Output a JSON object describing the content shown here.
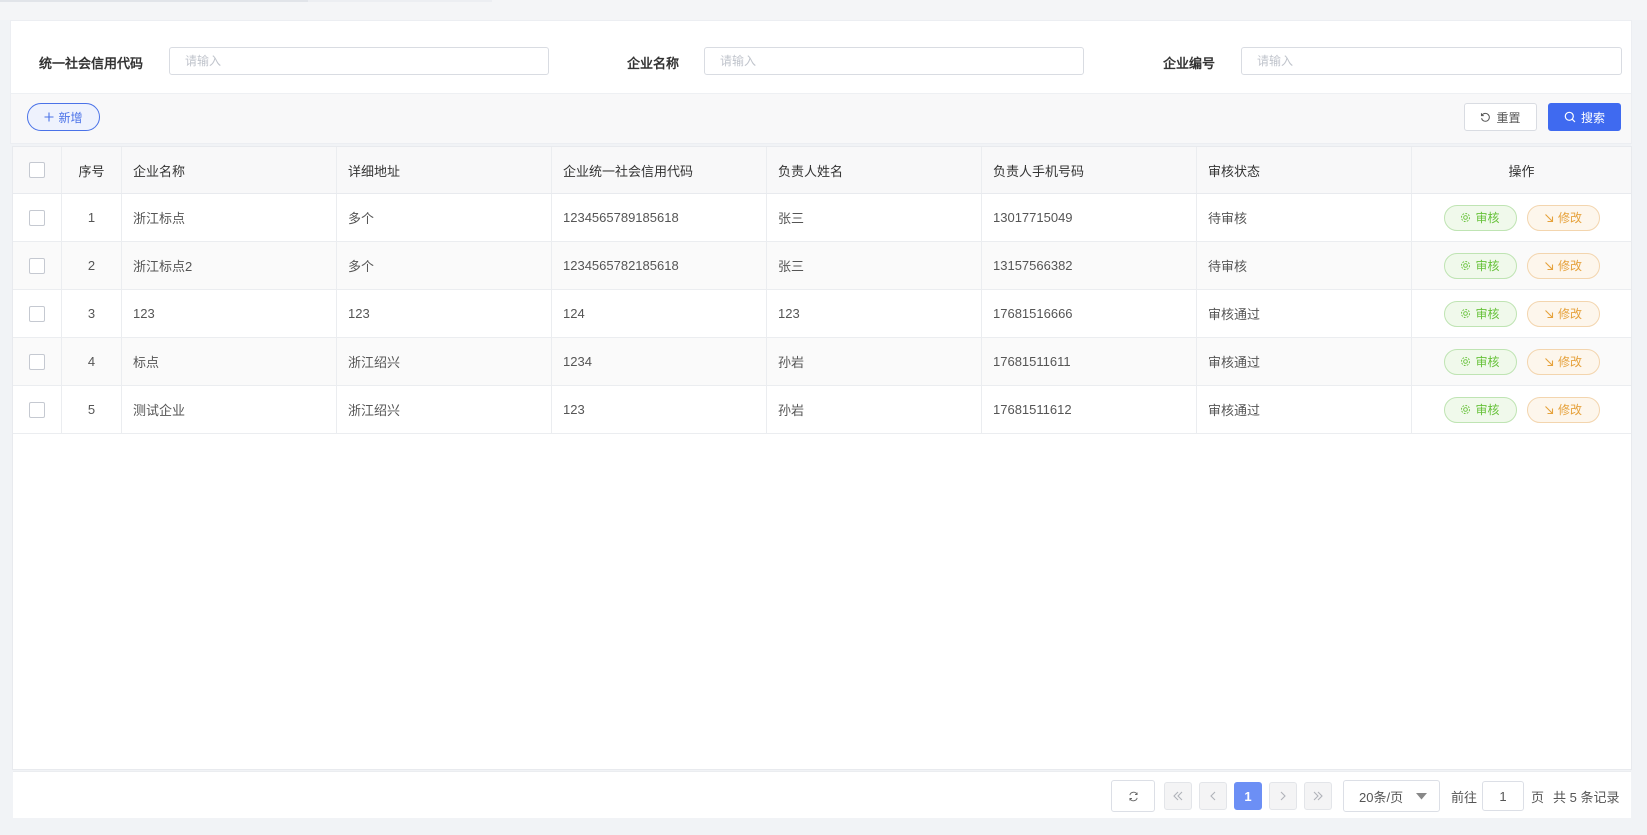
{
  "filters": [
    {
      "label": "统一社会信用代码",
      "placeholder": "请输入",
      "value": ""
    },
    {
      "label": "企业名称",
      "placeholder": "请输入",
      "value": ""
    },
    {
      "label": "企业编号",
      "placeholder": "请输入",
      "value": ""
    }
  ],
  "toolbar": {
    "add_label": "新增",
    "reset_label": "重置",
    "search_label": "搜索"
  },
  "table": {
    "columns": [
      "序号",
      "企业名称",
      "详细地址",
      "企业统一社会信用代码",
      "负责人姓名",
      "负责人手机号码",
      "审核状态",
      "操作"
    ],
    "rows": [
      {
        "index": "1",
        "name": "浙江标点",
        "address": "多个",
        "credit_code": "1234565789185618",
        "manager": "张三",
        "phone": "13017715049",
        "status": "待审核"
      },
      {
        "index": "2",
        "name": "浙江标点2",
        "address": "多个",
        "credit_code": "1234565782185618",
        "manager": "张三",
        "phone": "13157566382",
        "status": "待审核"
      },
      {
        "index": "3",
        "name": "123",
        "address": "123",
        "credit_code": "124",
        "manager": "123",
        "phone": "17681516666",
        "status": "审核通过"
      },
      {
        "index": "4",
        "name": "标点",
        "address": "浙江绍兴",
        "credit_code": "1234",
        "manager": "孙岩",
        "phone": "17681511611",
        "status": "审核通过"
      },
      {
        "index": "5",
        "name": "测试企业",
        "address": "浙江绍兴",
        "credit_code": "123",
        "manager": "孙岩",
        "phone": "17681511612",
        "status": "审核通过"
      }
    ],
    "actions": {
      "audit_label": "审核",
      "edit_label": "修改"
    }
  },
  "pagination": {
    "current_page": "1",
    "page_size": "20条/页",
    "goto_prefix": "前往",
    "goto_value": "1",
    "goto_suffix": "页",
    "total_text": "共 5 条记录"
  },
  "colors": {
    "primary": "#3f6af0",
    "audit_green": "#67c23a",
    "edit_orange": "#e6a23c",
    "active_page": "#6c8ff5"
  },
  "icons": {
    "add": "plus-icon",
    "reset": "refresh-icon",
    "search": "search-icon",
    "audit": "gear-icon",
    "edit": "arrow-down-right-icon"
  }
}
